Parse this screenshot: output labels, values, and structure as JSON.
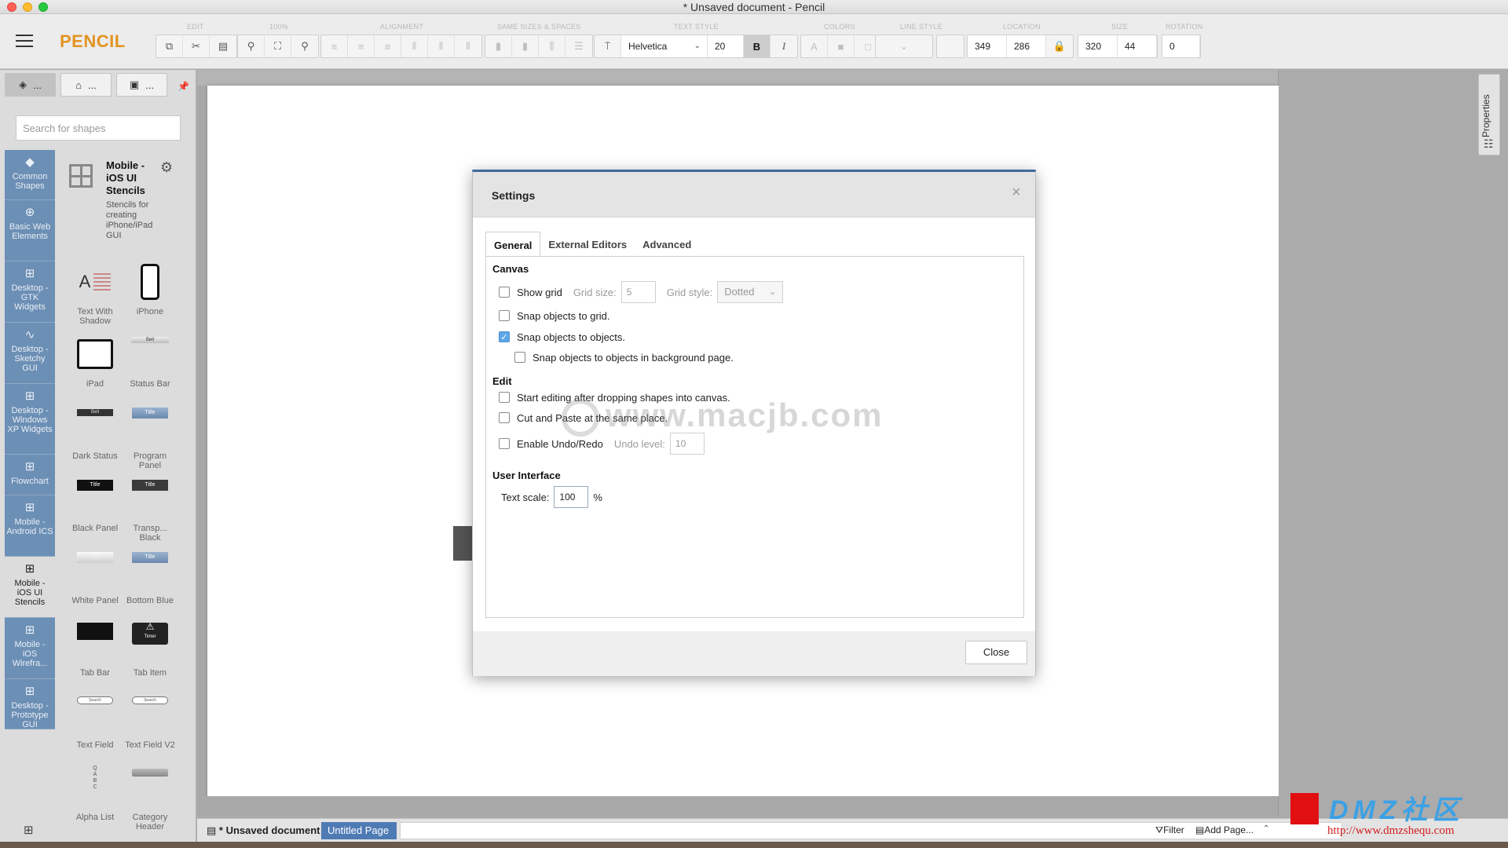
{
  "window": {
    "title": "* Unsaved document - Pencil"
  },
  "toolbar": {
    "app_name": "PENCIL",
    "groups": {
      "edit": "EDIT",
      "zoom": "100%",
      "alignment": "ALIGNMENT",
      "same_sizes": "SAME SIZES & SPACES",
      "text_style": "TEXT STYLE",
      "colors": "COLORS",
      "line_style": "LINE STYLE",
      "location": "LOCATION",
      "size": "SIZE",
      "rotation": "ROTATION"
    },
    "font_family": "Helvetica",
    "font_size": "20",
    "bold_label": "B",
    "italic_label": "I",
    "location_x": "349",
    "location_y": "286",
    "size_w": "320",
    "size_h": "44",
    "rotation": "0"
  },
  "sidebar": {
    "search_placeholder": "Search for shapes",
    "tab_more": "...",
    "collections": [
      {
        "label": "Common Shapes",
        "icon": "shapes-icon"
      },
      {
        "label": "Basic Web Elements",
        "icon": "globe-icon"
      },
      {
        "label": "Desktop - GTK Widgets",
        "icon": "grid-icon"
      },
      {
        "label": "Desktop - Sketchy GUI",
        "icon": "squiggle-icon"
      },
      {
        "label": "Desktop - Windows XP Widgets",
        "icon": "grid-icon"
      },
      {
        "label": "Flowchart",
        "icon": "grid-icon"
      },
      {
        "label": "Mobile - Android ICS",
        "icon": "grid-icon"
      },
      {
        "label": "Mobile - iOS UI Stencils",
        "icon": "grid-icon"
      },
      {
        "label": "Mobile - iOS Wirefra...",
        "icon": "grid-icon"
      },
      {
        "label": "Desktop - Prototype GUI",
        "icon": "grid-icon"
      }
    ],
    "stencil": {
      "name": "Mobile - iOS UI Stencils",
      "description": "Stencils for creating iPhone/iPad GUI"
    },
    "shapes": [
      {
        "label": "Text With Shadow"
      },
      {
        "label": "iPhone"
      },
      {
        "label": "iPad"
      },
      {
        "label": "Status Bar"
      },
      {
        "label": "Dark Status"
      },
      {
        "label": "Program Panel"
      },
      {
        "label": "Black Panel"
      },
      {
        "label": "Transp... Black"
      },
      {
        "label": "White Panel"
      },
      {
        "label": "Bottom Blue"
      },
      {
        "label": "Tab Bar"
      },
      {
        "label": "Tab Item"
      },
      {
        "label": "Text Field"
      },
      {
        "label": "Text Field V2"
      },
      {
        "label": "Alpha List"
      },
      {
        "label": "Category Header"
      }
    ],
    "thumb_text": {
      "title": "Title",
      "bell": "Bell",
      "tab": "Tab",
      "timer": "Timer",
      "search": "Search",
      "text_shadow_a": "A",
      "alpha_letters": "Q\nA\nB\nC"
    }
  },
  "properties_tab": {
    "label": "Properties"
  },
  "bottombar": {
    "document": "* Unsaved document",
    "page": "Untitled Page",
    "filter": "Filter",
    "add_page": "Add Page..."
  },
  "dialog": {
    "title": "Settings",
    "tabs": [
      "General",
      "External Editors",
      "Advanced"
    ],
    "sections": {
      "canvas": "Canvas",
      "edit": "Edit",
      "ui": "User Interface"
    },
    "show_grid": "Show grid",
    "grid_size_label": "Grid size:",
    "grid_size_value": "5",
    "grid_style_label": "Grid style:",
    "grid_style_value": "Dotted",
    "snap_grid": "Snap objects to grid.",
    "snap_objects": "Snap objects to objects.",
    "snap_background": "Snap objects to objects in background page.",
    "start_editing": "Start editing after dropping shapes into canvas.",
    "cut_paste": "Cut and Paste at the same place.",
    "undo_redo": "Enable Undo/Redo",
    "undo_level_label": "Undo level:",
    "undo_level_value": "10",
    "text_scale_label": "Text scale:",
    "text_scale_value": "100",
    "text_scale_unit": "%",
    "close_label": "Close",
    "checks": {
      "show_grid": false,
      "snap_grid": false,
      "snap_objects": true,
      "snap_background": false,
      "start_editing": false,
      "cut_paste": false,
      "undo_redo": false
    }
  },
  "watermark": {
    "text": "www.macjb.com"
  },
  "logo": {
    "text": "DMZ社区",
    "url": "http://www.dmzshequ.com"
  },
  "colors": {
    "accent": "#e39322",
    "sidebar_blue": "#6c8fb5",
    "page_tab": "#4f7bb5",
    "check_blue": "#5ea7e6"
  }
}
